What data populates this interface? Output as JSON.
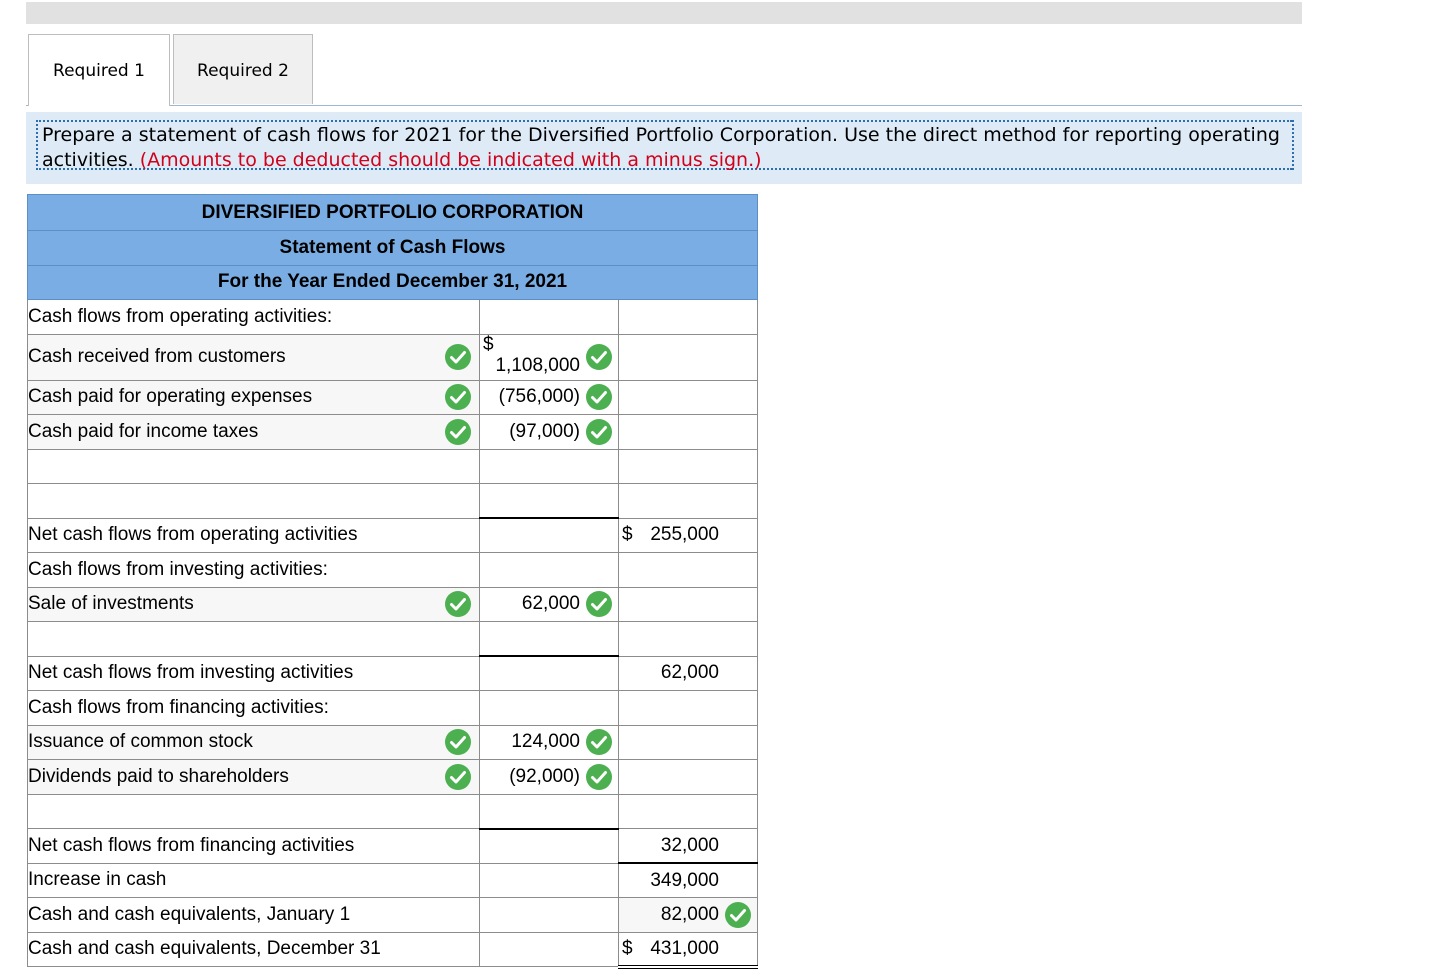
{
  "tabs": [
    {
      "label": "Required 1",
      "active": true
    },
    {
      "label": "Required 2",
      "active": false
    }
  ],
  "instructions": {
    "text": "Prepare a statement of cash flows for 2021 for the Diversified Portfolio Corporation. Use the direct method for reporting operating activities.",
    "note": "(Amounts to be deducted should be indicated with a minus sign.)"
  },
  "statement": {
    "company": "DIVERSIFIED PORTFOLIO CORPORATION",
    "title": "Statement of Cash Flows",
    "period": "For the Year Ended December 31, 2021"
  },
  "rows": {
    "op_header": "Cash flows from operating activities:",
    "op1_label": "Cash received from customers",
    "op1_value": "1,108,000",
    "op2_label": "Cash paid for operating expenses",
    "op2_value": "(756,000)",
    "op3_label": "Cash paid for income taxes",
    "op3_value": "(97,000)",
    "op_net_label": "Net cash flows from operating activities",
    "op_net_value": "255,000",
    "inv_header": "Cash flows from investing activities:",
    "inv1_label": "Sale of investments",
    "inv1_value": "62,000",
    "inv_net_label": "Net cash flows from investing activities",
    "inv_net_value": "62,000",
    "fin_header": "Cash flows from financing activities:",
    "fin1_label": "Issuance of common stock",
    "fin1_value": "124,000",
    "fin2_label": "Dividends paid to shareholders",
    "fin2_value": "(92,000)",
    "fin_net_label": "Net cash flows from financing activities",
    "fin_net_value": "32,000",
    "inc_label": "Increase in cash",
    "inc_value": "349,000",
    "jan_label": "Cash and cash equivalents, January 1",
    "jan_value": "82,000",
    "dec_label": "Cash and cash equivalents, December 31",
    "dec_value": "431,000"
  },
  "currency_symbol": "$",
  "colors": {
    "header_blue": "#7aade3",
    "check_green": "#4caf50",
    "note_red": "#d0021b",
    "instructions_bg": "#deebf7"
  },
  "icons": {
    "correct": "check-circle-icon"
  }
}
